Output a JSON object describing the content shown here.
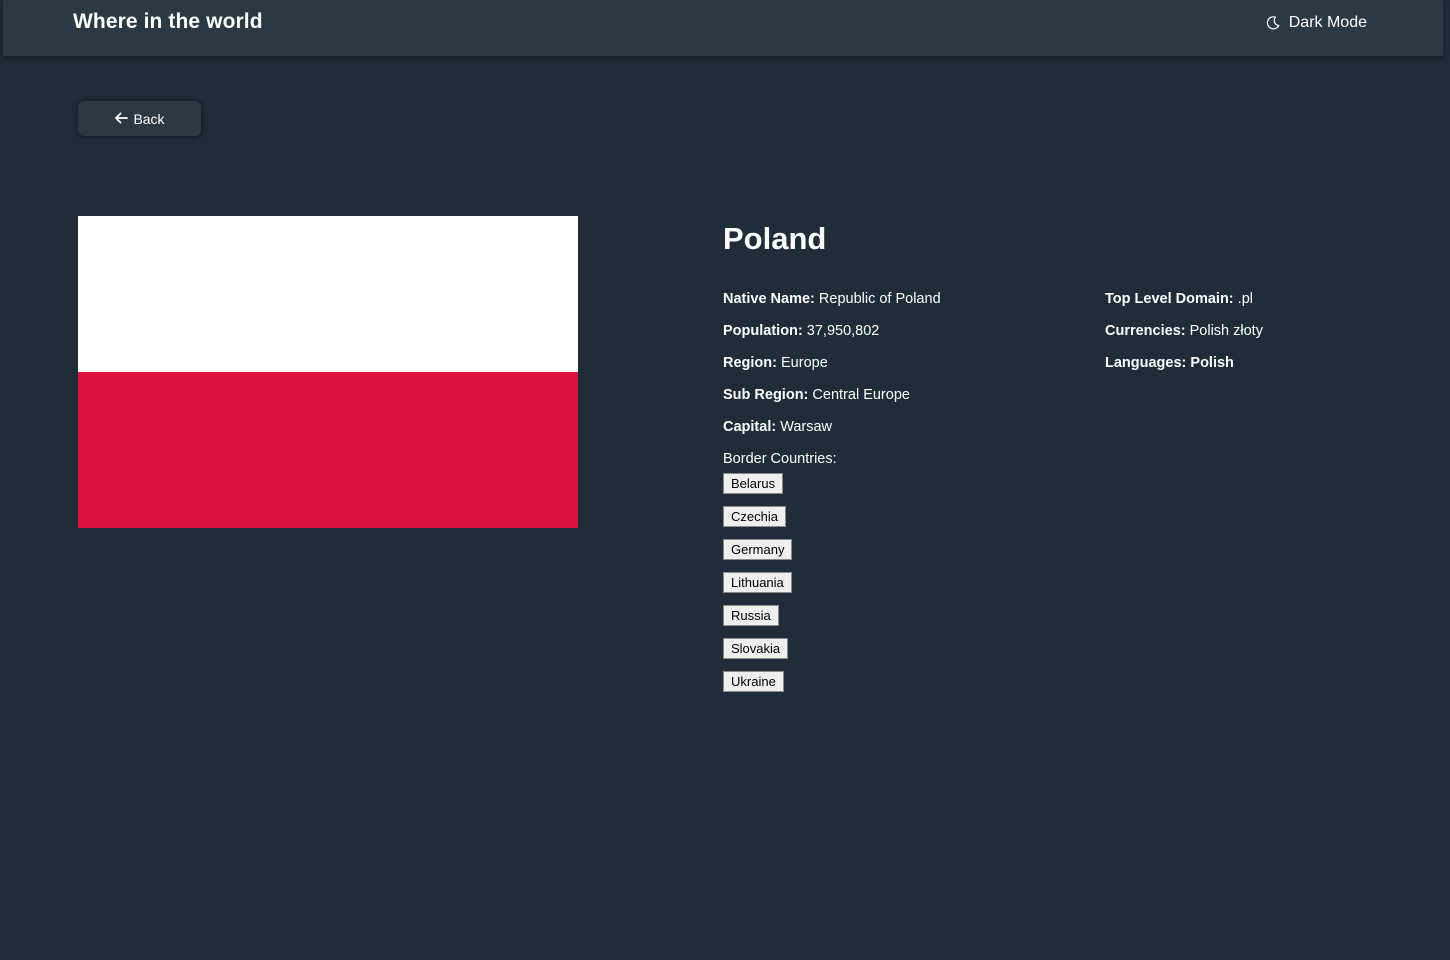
{
  "header": {
    "title": "Where in the world",
    "mode_toggle": {
      "icon": "moon-icon",
      "label": "Dark Mode"
    }
  },
  "back_button": {
    "icon": "arrow-left-icon",
    "label": "Back"
  },
  "country": {
    "name": "Poland",
    "flag": {
      "colors": [
        "#ffffff",
        "#dc143c"
      ]
    },
    "details_left": [
      {
        "key": "Native Name:",
        "value": "Republic of Poland"
      },
      {
        "key": "Population:",
        "value": "37,950,802"
      },
      {
        "key": "Region:",
        "value": "Europe"
      },
      {
        "key": "Sub Region:",
        "value": "Central Europe"
      },
      {
        "key": "Capital:",
        "value": "Warsaw"
      }
    ],
    "details_right": [
      {
        "key": "Top Level Domain:",
        "value": ".pl"
      },
      {
        "key": "Currencies:",
        "value": "Polish złoty"
      },
      {
        "key": "Languages:",
        "value": "Polish"
      }
    ],
    "border_countries_label": "Border Countries:",
    "border_countries": [
      "Belarus",
      "Czechia",
      "Germany",
      "Lithuania",
      "Russia",
      "Slovakia",
      "Ukraine"
    ]
  },
  "colors": {
    "background": "#202c3a",
    "surface": "#2b3945",
    "text": "#ffffff"
  }
}
